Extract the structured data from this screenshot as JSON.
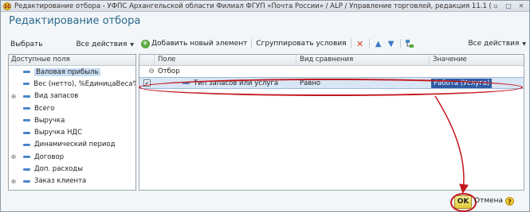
{
  "window": {
    "title": "Редактирование отбора - УФПС Архангельской области Филиал ФГУП «Почта России» / ALP / Управление торговлей, редакция 11.1  (1С:Предприятие)",
    "app_icon_text": "1С",
    "controls": [
      "▫",
      "□",
      "✕"
    ]
  },
  "heading": "Редактирование отбора",
  "left_toolbar": {
    "select_label": "Выбрать",
    "all_actions_label": "Все действия"
  },
  "right_toolbar": {
    "add_label": "Добавить новый элемент",
    "group_label": "Сгруппировать условия",
    "all_actions_label": "Все действия"
  },
  "fields_panel": {
    "header": "Доступные поля",
    "items": [
      {
        "label": "Валовая прибыль",
        "expandable": false,
        "selected": true
      },
      {
        "label": "Вес (нетто), %ЕдиницаВеса%",
        "expandable": false,
        "selected": false
      },
      {
        "label": "Вид запасов",
        "expandable": true,
        "selected": false
      },
      {
        "label": "Всего",
        "expandable": false,
        "selected": false
      },
      {
        "label": "Выручка",
        "expandable": false,
        "selected": false
      },
      {
        "label": "Выручка НДС",
        "expandable": false,
        "selected": false
      },
      {
        "label": "Динамический период",
        "expandable": false,
        "selected": false
      },
      {
        "label": "Договор",
        "expandable": true,
        "selected": false
      },
      {
        "label": "Доп. расходы",
        "expandable": false,
        "selected": false
      },
      {
        "label": "Заказ клиента",
        "expandable": true,
        "selected": false
      }
    ]
  },
  "grid": {
    "columns": {
      "field": "Поле",
      "compare": "Вид сравнения",
      "value": "Значение"
    },
    "group_row": {
      "expander": "⊖",
      "label": "Отбор"
    },
    "rows": [
      {
        "checked": true,
        "field": "Тип запасов или услуга",
        "compare": "Равно",
        "value": "Работа (Услуга)"
      }
    ]
  },
  "footer": {
    "ok_label": "OK",
    "cancel_label": "Отмена",
    "help_label": "?"
  },
  "colors": {
    "heading": "#2a6a8e",
    "annotation": "#c4161c",
    "value_highlight": "#2f5aa3",
    "ok_button": "#e2c833"
  }
}
